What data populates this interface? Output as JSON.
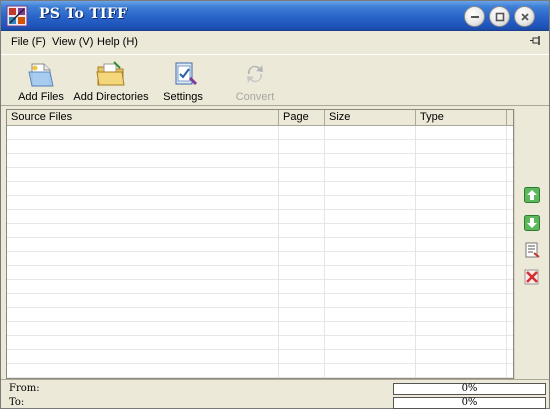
{
  "window": {
    "title": "PS To TIFF"
  },
  "menu": [
    {
      "label": "File (F)"
    },
    {
      "label": "View (V)"
    },
    {
      "label": "Help (H)"
    }
  ],
  "toolbar": {
    "add_files": "Add Files",
    "add_directories": "Add Directories",
    "settings": "Settings",
    "convert": "Convert"
  },
  "table": {
    "columns": [
      "Source Files",
      "Page",
      "Size",
      "Type"
    ],
    "rows": []
  },
  "side_buttons": [
    "move-up-icon",
    "move-down-icon",
    "properties-icon",
    "delete-icon"
  ],
  "status": {
    "from_label": "From:",
    "to_label": "To:",
    "from_progress": "0%",
    "to_progress": "0%",
    "from_progress_value": 0,
    "to_progress_value": 0
  },
  "colors": {
    "titlebar": "#2964c9",
    "window_bg": "#ece9d8"
  }
}
